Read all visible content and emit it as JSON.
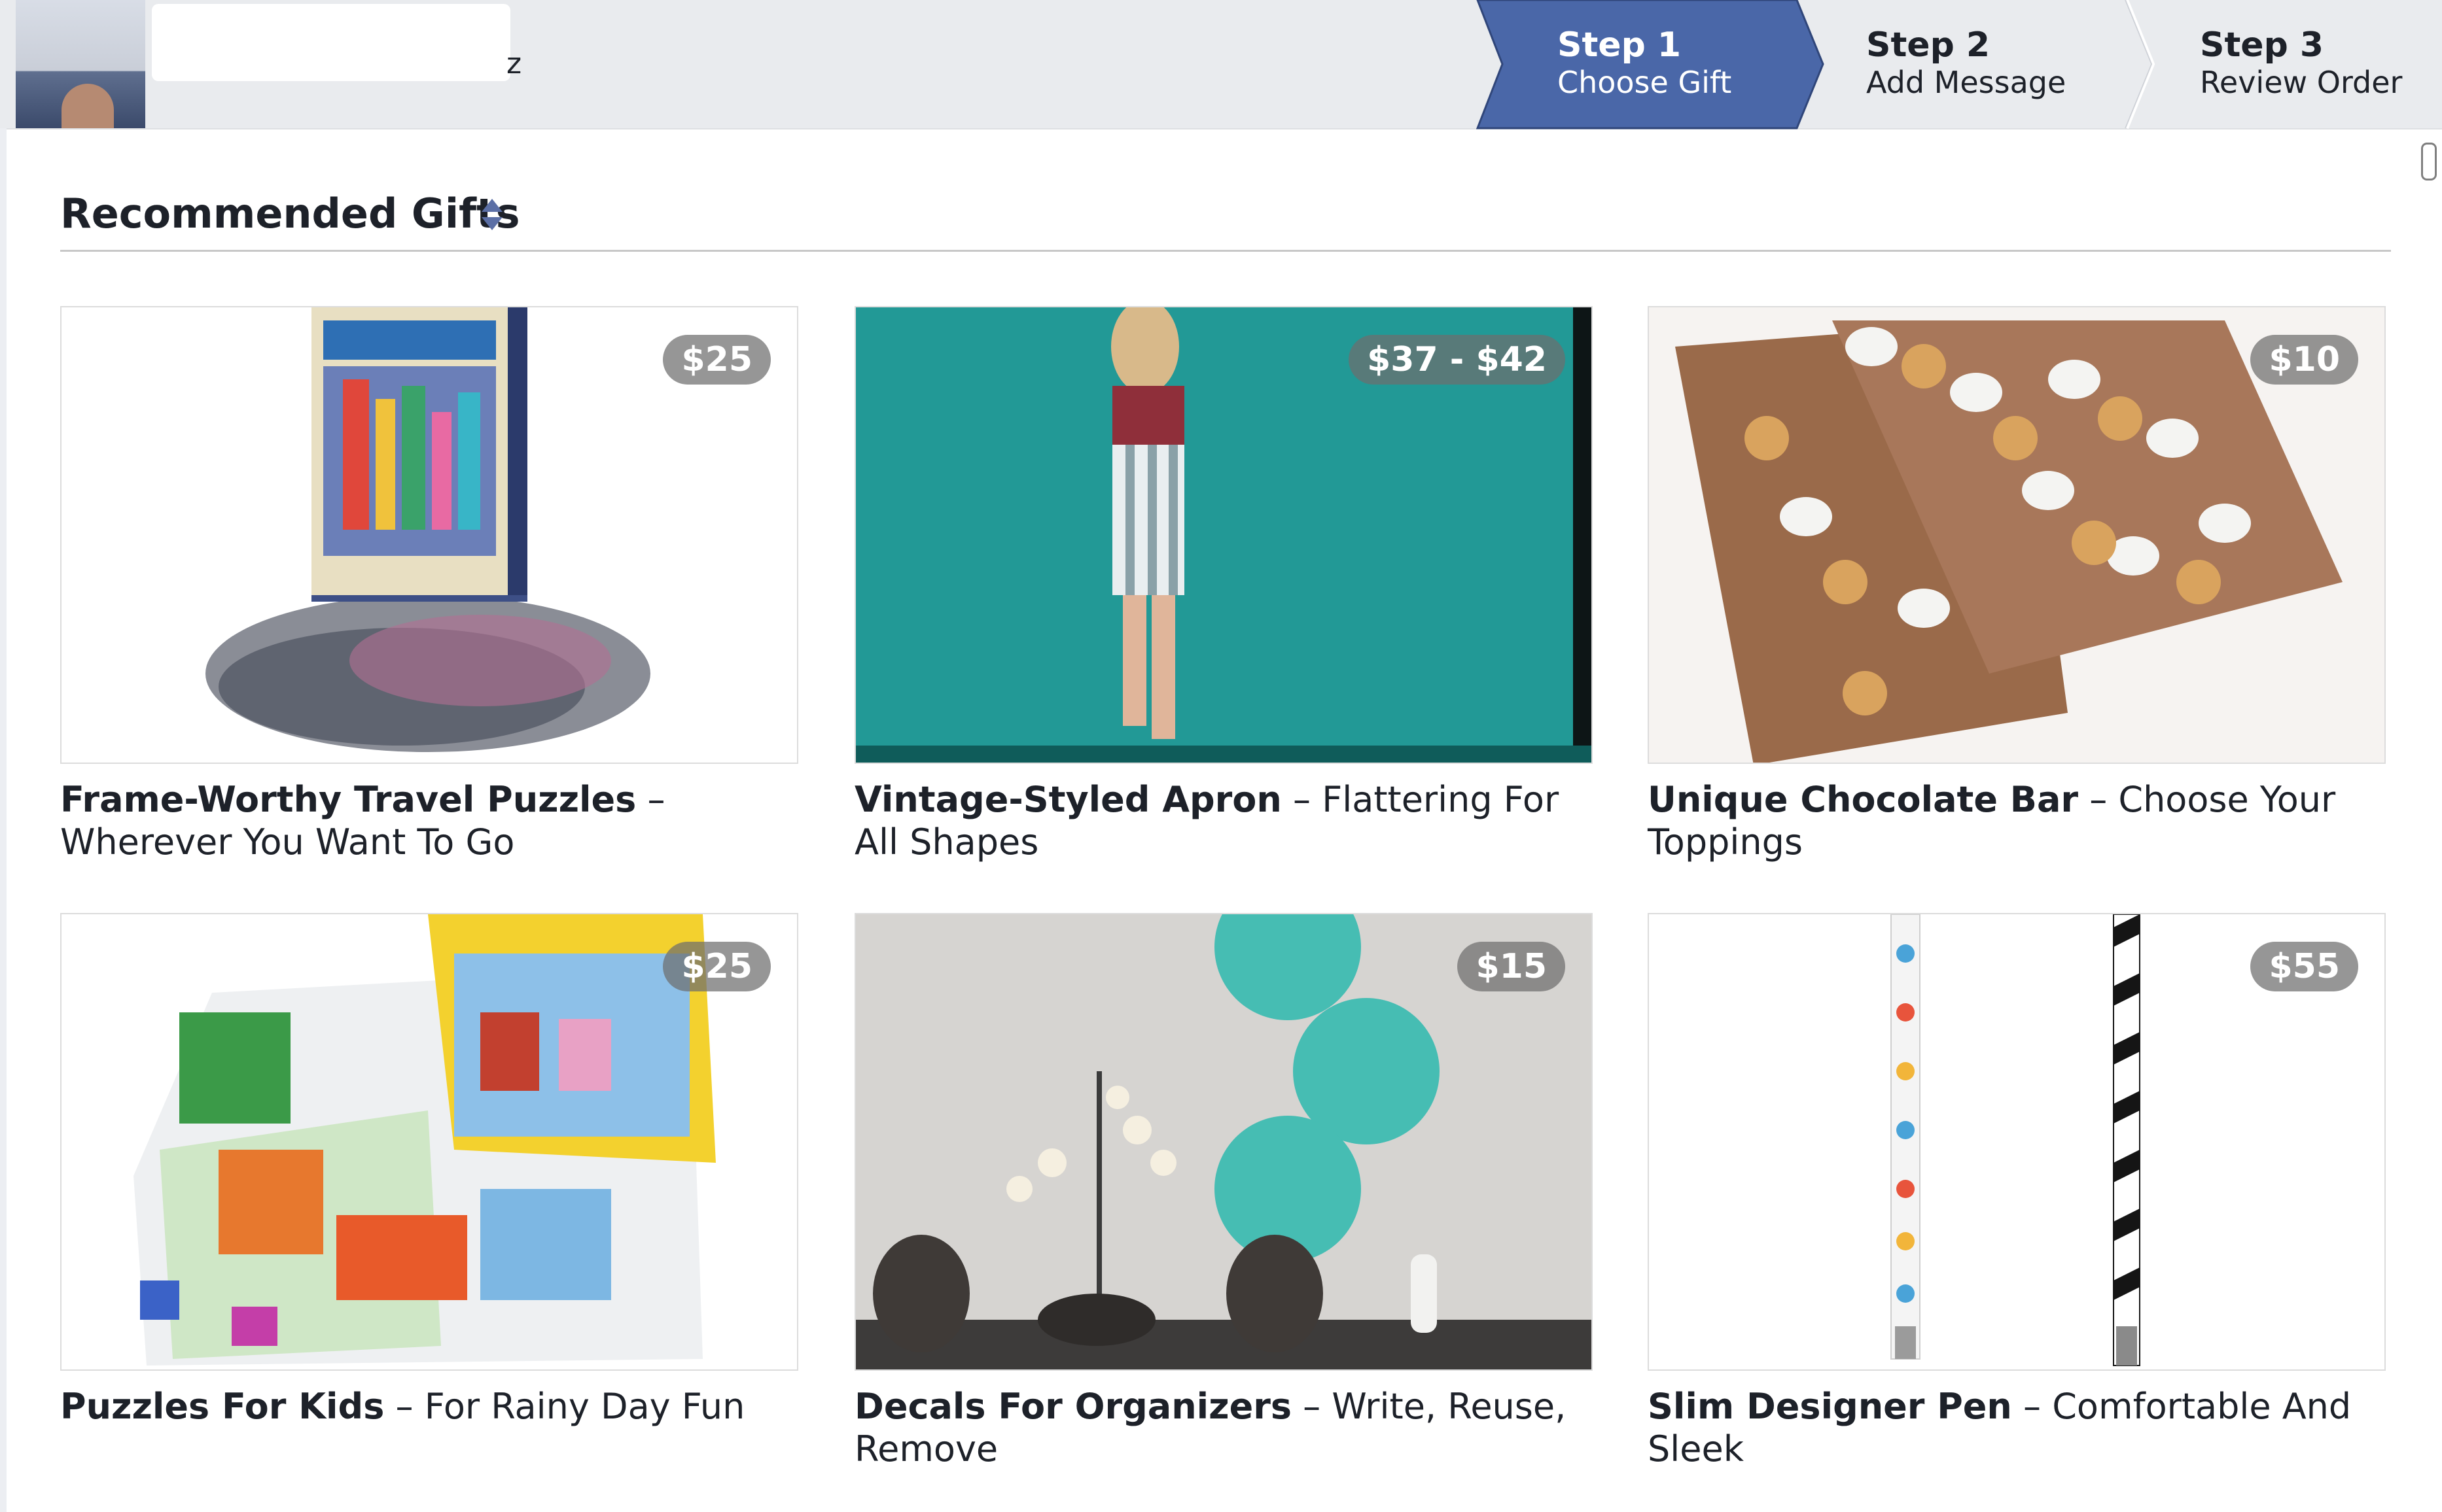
{
  "steps": [
    {
      "number": "Step 1",
      "label": "Choose Gift",
      "active": true
    },
    {
      "number": "Step 2",
      "label": "Add Message",
      "active": false
    },
    {
      "number": "Step 3",
      "label": "Review Order",
      "active": false
    }
  ],
  "header": {
    "name_tail": "z"
  },
  "section": {
    "title": "Recommended Gifts",
    "sort_icon": "sort-arrows-icon"
  },
  "gifts": [
    {
      "price": "$25",
      "name": "Frame-Worthy Travel Puzzles",
      "tagline": "Wherever You Want To Go",
      "image": "new-york-puzzle-image"
    },
    {
      "price": "$37 - $42",
      "name": "Vintage-Styled Apron",
      "tagline": "Flattering For All Shapes",
      "image": "apron-model-image"
    },
    {
      "price": "$10",
      "name": "Unique Chocolate Bar",
      "tagline": "Choose Your Toppings",
      "image": "chocolate-bar-image"
    },
    {
      "price": "$25",
      "name": "Puzzles For Kids",
      "tagline": "For Rainy Day Fun",
      "image": "kids-puzzle-image"
    },
    {
      "price": "$15",
      "name": "Decals For Organizers",
      "tagline": "Write, Reuse, Remove",
      "image": "wall-decals-image"
    },
    {
      "price": "$55",
      "name": "Slim Designer Pen",
      "tagline": "Comfortable And Sleek",
      "image": "designer-pens-image"
    }
  ],
  "colors": {
    "active_step": "#4a67a8",
    "header_bg": "#e9ebee",
    "price_badge": "#6e6e6e",
    "sort_icon": "#5b6fa6"
  }
}
